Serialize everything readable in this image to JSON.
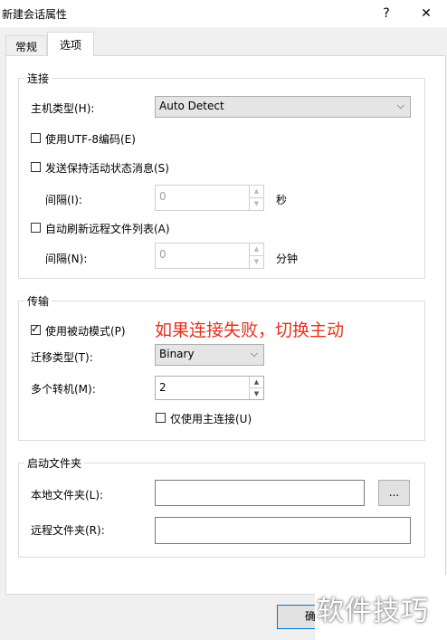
{
  "window": {
    "title": "新建会话属性",
    "help": "?",
    "close": "✕"
  },
  "tabs": [
    {
      "label": "常规"
    },
    {
      "label": "选项"
    }
  ],
  "connection": {
    "title": "连接",
    "host_type_label": "主机类型(H):",
    "host_type_value": "Auto Detect",
    "utf8_label": "使用UTF-8编码(E)",
    "keepalive_label": "发送保持活动状态消息(S)",
    "keepalive_interval_label": "间隔(I):",
    "keepalive_interval_value": "0",
    "keepalive_unit": "秒",
    "autorefresh_label": "自动刷新远程文件列表(A)",
    "autorefresh_interval_label": "间隔(N):",
    "autorefresh_interval_value": "0",
    "autorefresh_unit": "分钟"
  },
  "transfer": {
    "title": "传输",
    "passive_label": "使用被动模式(P)",
    "passive_checked": true,
    "type_label": "迁移类型(T):",
    "type_value": "Binary",
    "multi_label": "多个转机(M):",
    "multi_value": "2",
    "primary_only_label": "仅使用主连接(U)"
  },
  "startup_folder": {
    "title": "启动文件夹",
    "local_label": "本地文件夹(L):",
    "local_value": "",
    "browse_label": "...",
    "remote_label": "远程文件夹(R):",
    "remote_value": ""
  },
  "annotation": "如果连接失败，切换主动",
  "ok_button_partial": "确",
  "watermark": "软件技巧"
}
